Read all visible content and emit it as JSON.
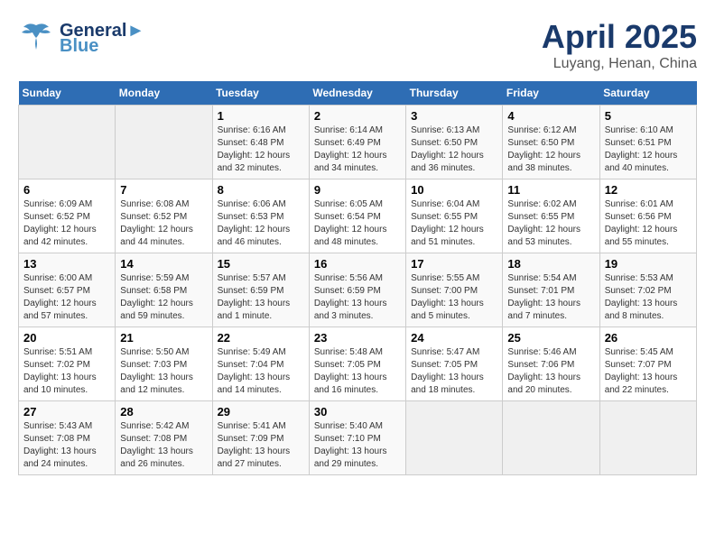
{
  "header": {
    "logo_line1": "General",
    "logo_line2": "Blue",
    "title": "April 2025",
    "subtitle": "Luyang, Henan, China"
  },
  "columns": [
    "Sunday",
    "Monday",
    "Tuesday",
    "Wednesday",
    "Thursday",
    "Friday",
    "Saturday"
  ],
  "weeks": [
    [
      {
        "day": "",
        "info": ""
      },
      {
        "day": "",
        "info": ""
      },
      {
        "day": "1",
        "info": "Sunrise: 6:16 AM\nSunset: 6:48 PM\nDaylight: 12 hours\nand 32 minutes."
      },
      {
        "day": "2",
        "info": "Sunrise: 6:14 AM\nSunset: 6:49 PM\nDaylight: 12 hours\nand 34 minutes."
      },
      {
        "day": "3",
        "info": "Sunrise: 6:13 AM\nSunset: 6:50 PM\nDaylight: 12 hours\nand 36 minutes."
      },
      {
        "day": "4",
        "info": "Sunrise: 6:12 AM\nSunset: 6:50 PM\nDaylight: 12 hours\nand 38 minutes."
      },
      {
        "day": "5",
        "info": "Sunrise: 6:10 AM\nSunset: 6:51 PM\nDaylight: 12 hours\nand 40 minutes."
      }
    ],
    [
      {
        "day": "6",
        "info": "Sunrise: 6:09 AM\nSunset: 6:52 PM\nDaylight: 12 hours\nand 42 minutes."
      },
      {
        "day": "7",
        "info": "Sunrise: 6:08 AM\nSunset: 6:52 PM\nDaylight: 12 hours\nand 44 minutes."
      },
      {
        "day": "8",
        "info": "Sunrise: 6:06 AM\nSunset: 6:53 PM\nDaylight: 12 hours\nand 46 minutes."
      },
      {
        "day": "9",
        "info": "Sunrise: 6:05 AM\nSunset: 6:54 PM\nDaylight: 12 hours\nand 48 minutes."
      },
      {
        "day": "10",
        "info": "Sunrise: 6:04 AM\nSunset: 6:55 PM\nDaylight: 12 hours\nand 51 minutes."
      },
      {
        "day": "11",
        "info": "Sunrise: 6:02 AM\nSunset: 6:55 PM\nDaylight: 12 hours\nand 53 minutes."
      },
      {
        "day": "12",
        "info": "Sunrise: 6:01 AM\nSunset: 6:56 PM\nDaylight: 12 hours\nand 55 minutes."
      }
    ],
    [
      {
        "day": "13",
        "info": "Sunrise: 6:00 AM\nSunset: 6:57 PM\nDaylight: 12 hours\nand 57 minutes."
      },
      {
        "day": "14",
        "info": "Sunrise: 5:59 AM\nSunset: 6:58 PM\nDaylight: 12 hours\nand 59 minutes."
      },
      {
        "day": "15",
        "info": "Sunrise: 5:57 AM\nSunset: 6:59 PM\nDaylight: 13 hours\nand 1 minute."
      },
      {
        "day": "16",
        "info": "Sunrise: 5:56 AM\nSunset: 6:59 PM\nDaylight: 13 hours\nand 3 minutes."
      },
      {
        "day": "17",
        "info": "Sunrise: 5:55 AM\nSunset: 7:00 PM\nDaylight: 13 hours\nand 5 minutes."
      },
      {
        "day": "18",
        "info": "Sunrise: 5:54 AM\nSunset: 7:01 PM\nDaylight: 13 hours\nand 7 minutes."
      },
      {
        "day": "19",
        "info": "Sunrise: 5:53 AM\nSunset: 7:02 PM\nDaylight: 13 hours\nand 8 minutes."
      }
    ],
    [
      {
        "day": "20",
        "info": "Sunrise: 5:51 AM\nSunset: 7:02 PM\nDaylight: 13 hours\nand 10 minutes."
      },
      {
        "day": "21",
        "info": "Sunrise: 5:50 AM\nSunset: 7:03 PM\nDaylight: 13 hours\nand 12 minutes."
      },
      {
        "day": "22",
        "info": "Sunrise: 5:49 AM\nSunset: 7:04 PM\nDaylight: 13 hours\nand 14 minutes."
      },
      {
        "day": "23",
        "info": "Sunrise: 5:48 AM\nSunset: 7:05 PM\nDaylight: 13 hours\nand 16 minutes."
      },
      {
        "day": "24",
        "info": "Sunrise: 5:47 AM\nSunset: 7:05 PM\nDaylight: 13 hours\nand 18 minutes."
      },
      {
        "day": "25",
        "info": "Sunrise: 5:46 AM\nSunset: 7:06 PM\nDaylight: 13 hours\nand 20 minutes."
      },
      {
        "day": "26",
        "info": "Sunrise: 5:45 AM\nSunset: 7:07 PM\nDaylight: 13 hours\nand 22 minutes."
      }
    ],
    [
      {
        "day": "27",
        "info": "Sunrise: 5:43 AM\nSunset: 7:08 PM\nDaylight: 13 hours\nand 24 minutes."
      },
      {
        "day": "28",
        "info": "Sunrise: 5:42 AM\nSunset: 7:08 PM\nDaylight: 13 hours\nand 26 minutes."
      },
      {
        "day": "29",
        "info": "Sunrise: 5:41 AM\nSunset: 7:09 PM\nDaylight: 13 hours\nand 27 minutes."
      },
      {
        "day": "30",
        "info": "Sunrise: 5:40 AM\nSunset: 7:10 PM\nDaylight: 13 hours\nand 29 minutes."
      },
      {
        "day": "",
        "info": ""
      },
      {
        "day": "",
        "info": ""
      },
      {
        "day": "",
        "info": ""
      }
    ]
  ]
}
